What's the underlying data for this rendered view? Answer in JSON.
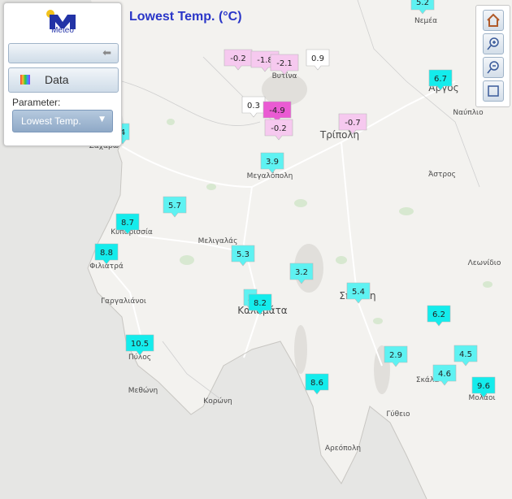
{
  "title": "Lowest Temp. (°C)",
  "logo_text": "Meteo",
  "panel": {
    "data_button": "Data",
    "parameter_label": "Parameter:",
    "parameter_value": "Lowest Temp."
  },
  "colors": {
    "cold": "#ea5bd3",
    "mild": "#f6c9ef",
    "neutral": "#ffffff",
    "warm": "#5ef2f2",
    "hot": "#14ecec"
  },
  "towns": [
    {
      "name": "Νεμέα"
    },
    {
      "name": "Άργος"
    },
    {
      "name": "Ναύπλιο"
    },
    {
      "name": "Τρίπολη"
    },
    {
      "name": "Βυτίνα"
    },
    {
      "name": "Μεγαλόπολη"
    },
    {
      "name": "Άστρος"
    },
    {
      "name": "Λεωνίδιο"
    },
    {
      "name": "Μελιγαλάς"
    },
    {
      "name": "Κυπαρισσία"
    },
    {
      "name": "Φιλιατρά"
    },
    {
      "name": "Γαργαλιάνοι"
    },
    {
      "name": "Καλαμάτα"
    },
    {
      "name": "Σπάρτη"
    },
    {
      "name": "Πύλος"
    },
    {
      "name": "Μεθώνη"
    },
    {
      "name": "Κορώνη"
    },
    {
      "name": "Γύθειο"
    },
    {
      "name": "Αρεόπολη"
    },
    {
      "name": "Σκάλα"
    },
    {
      "name": "Μολάοι"
    },
    {
      "name": "Ζαχάρω"
    }
  ],
  "stations": [
    {
      "value": "5.2"
    },
    {
      "value": "6.7"
    },
    {
      "value": "-0.2"
    },
    {
      "value": "-1.8"
    },
    {
      "value": "-2.1"
    },
    {
      "value": "0.9"
    },
    {
      "value": "0.3"
    },
    {
      "value": "-4.9"
    },
    {
      "value": "-0.2"
    },
    {
      "value": "-0.7"
    },
    {
      "value": "4"
    },
    {
      "value": "3.9"
    },
    {
      "value": "5.7"
    },
    {
      "value": "8.7"
    },
    {
      "value": "8.8"
    },
    {
      "value": "5.3"
    },
    {
      "value": "3.2"
    },
    {
      "value": "5.4"
    },
    {
      "value": "5"
    },
    {
      "value": "8.2"
    },
    {
      "value": "6.2"
    },
    {
      "value": "10.5"
    },
    {
      "value": "2.9"
    },
    {
      "value": "4.5"
    },
    {
      "value": "4.6"
    },
    {
      "value": "9.6"
    },
    {
      "value": "8.6"
    }
  ]
}
